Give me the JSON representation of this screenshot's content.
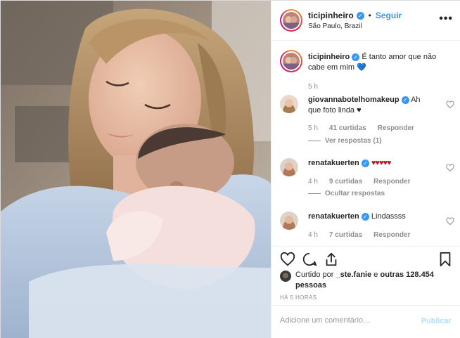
{
  "header": {
    "username": "ticipinheiro",
    "separator": "•",
    "follow_label": "Seguir",
    "location": "São Paulo, Brazil",
    "more_label": "•••"
  },
  "caption": {
    "username": "ticipinheiro",
    "text": "É tanto amor que não cabe em mim",
    "emoji": "💙",
    "time": "5 h"
  },
  "comments": [
    {
      "username": "giovannabotelhomakeup",
      "text": "Ah que foto linda ♥",
      "time": "5 h",
      "likes": "41 curtidas",
      "reply_label": "Responder",
      "thread_label": "Ver respostas (1)"
    },
    {
      "username": "renatakuerten",
      "text": "♥♥♥♥♥",
      "time": "4 h",
      "likes": "9 curtidas",
      "reply_label": "Responder",
      "thread_label": "Ocultar respostas"
    },
    {
      "username": "renatakuerten",
      "text": "Lindassss",
      "time": "4 h",
      "likes": "7 curtidas",
      "reply_label": "Responder"
    }
  ],
  "likes": {
    "prefix": "Curtido por",
    "user": "_ste.fanie",
    "middle": "e",
    "others": "outras 128.454 pessoas"
  },
  "post_time": "HÁ 5 HORAS",
  "add_comment": {
    "placeholder": "Adicione um comentário...",
    "publish_label": "Publicar"
  },
  "icons": {
    "like": "heart-icon",
    "comment": "comment-icon",
    "share": "share-icon",
    "save": "bookmark-icon",
    "verified": "verified-badge-icon",
    "more": "more-options-icon"
  },
  "colors": {
    "link": "#3897f0",
    "muted": "#8e8e8e",
    "border": "#efefef",
    "publish_disabled": "#b2dffc"
  }
}
